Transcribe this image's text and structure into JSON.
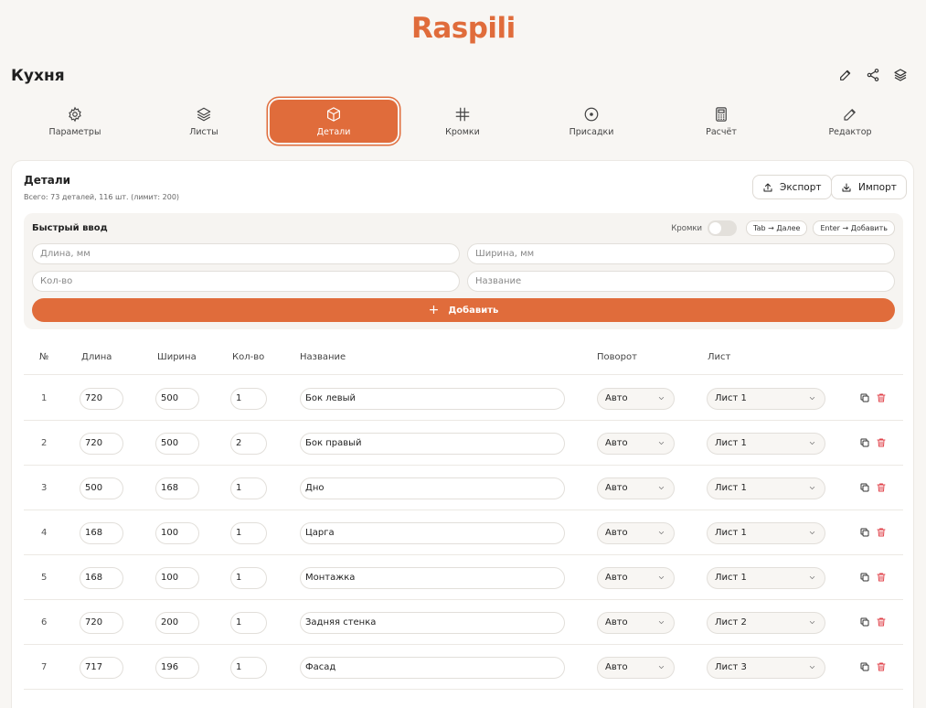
{
  "brand": {
    "logo": "Raspili",
    "accent": "#e06c3b"
  },
  "page": {
    "title": "Кухня"
  },
  "top_actions": [
    {
      "icon": "pencil-icon"
    },
    {
      "icon": "share-icon"
    },
    {
      "icon": "layers-icon"
    }
  ],
  "tabs": [
    {
      "label": "Параметры",
      "icon": "gear-icon",
      "active": false
    },
    {
      "label": "Листы",
      "icon": "layers-icon",
      "active": false
    },
    {
      "label": "Детали",
      "icon": "cube-icon",
      "active": true
    },
    {
      "label": "Кромки",
      "icon": "hash-icon",
      "active": false
    },
    {
      "label": "Присадки",
      "icon": "target-icon",
      "active": false
    },
    {
      "label": "Расчёт",
      "icon": "calculator-icon",
      "active": false
    },
    {
      "label": "Редактор",
      "icon": "pencil-icon",
      "active": false
    }
  ],
  "details": {
    "title": "Детали",
    "subtitle": "Всего: 73 деталей, 116 шт. (лимит: 200)",
    "export_label": "Экспорт",
    "import_label": "Импорт"
  },
  "quick_input": {
    "title": "Быстрый ввод",
    "edges_label": "Кромки",
    "edges_enabled": false,
    "hint_tab": "Tab → Далее",
    "hint_enter": "Enter → Добавить",
    "length_placeholder": "Длина, мм",
    "width_placeholder": "Ширина, мм",
    "qty_placeholder": "Кол-во",
    "name_placeholder": "Название",
    "add_label": "Добавить"
  },
  "table": {
    "columns": [
      "№",
      "Длина",
      "Ширина",
      "Кол-во",
      "Название",
      "Поворот",
      "Лист"
    ],
    "rows": [
      {
        "num": "1",
        "length": "720",
        "width": "500",
        "qty": "1",
        "name": "Бок левый",
        "rotation": "Авто",
        "sheet": "Лист 1"
      },
      {
        "num": "2",
        "length": "720",
        "width": "500",
        "qty": "2",
        "name": "Бок правый",
        "rotation": "Авто",
        "sheet": "Лист 1"
      },
      {
        "num": "3",
        "length": "500",
        "width": "168",
        "qty": "1",
        "name": "Дно",
        "rotation": "Авто",
        "sheet": "Лист 1"
      },
      {
        "num": "4",
        "length": "168",
        "width": "100",
        "qty": "1",
        "name": "Царга",
        "rotation": "Авто",
        "sheet": "Лист 1"
      },
      {
        "num": "5",
        "length": "168",
        "width": "100",
        "qty": "1",
        "name": "Монтажка",
        "rotation": "Авто",
        "sheet": "Лист 1"
      },
      {
        "num": "6",
        "length": "720",
        "width": "200",
        "qty": "1",
        "name": "Задняя стенка",
        "rotation": "Авто",
        "sheet": "Лист 2"
      },
      {
        "num": "7",
        "length": "717",
        "width": "196",
        "qty": "1",
        "name": "Фасад",
        "rotation": "Авто",
        "sheet": "Лист 3"
      }
    ]
  }
}
